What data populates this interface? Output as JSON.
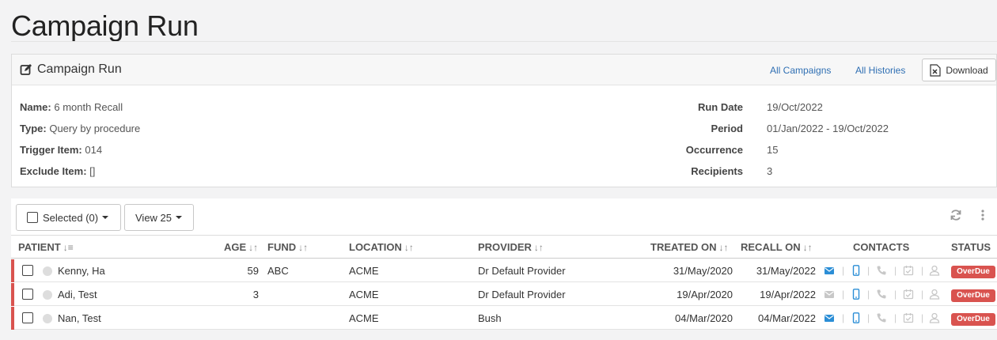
{
  "page": {
    "title": "Campaign Run"
  },
  "panel": {
    "title": "Campaign Run",
    "links": {
      "all_campaigns": "All Campaigns",
      "all_histories": "All Histories"
    },
    "download_label": "Download",
    "info_left": [
      {
        "label": "Name:",
        "value": "6 month Recall"
      },
      {
        "label": "Type:",
        "value": "Query by procedure"
      },
      {
        "label": "Trigger Item:",
        "value": "014"
      },
      {
        "label": "Exclude Item:",
        "value": "[]"
      }
    ],
    "info_right": [
      {
        "label": "Run Date",
        "value": "19/Oct/2022"
      },
      {
        "label": "Period",
        "value": "01/Jan/2022 - 19/Oct/2022"
      },
      {
        "label": "Occurrence",
        "value": "15"
      },
      {
        "label": "Recipients",
        "value": "3"
      }
    ]
  },
  "toolbar": {
    "selected_label": "Selected (0)",
    "view_label": "View 25"
  },
  "table": {
    "headers": {
      "patient": "PATIENT",
      "age": "AGE",
      "fund": "FUND",
      "location": "LOCATION",
      "provider": "PROVIDER",
      "treated_on": "TREATED ON",
      "recall_on": "RECALL ON",
      "contacts": "CONTACTS",
      "status": "STATUS"
    },
    "rows": [
      {
        "patient": "Kenny, Ha",
        "age": "59",
        "fund": "ABC",
        "location": "ACME",
        "provider": "Dr Default Provider",
        "treated_on": "31/May/2020",
        "recall_on": "31/May/2022",
        "email_active": true,
        "status": "OverDue"
      },
      {
        "patient": "Adi, Test",
        "age": "3",
        "fund": "",
        "location": "ACME",
        "provider": "Dr Default Provider",
        "treated_on": "19/Apr/2020",
        "recall_on": "19/Apr/2022",
        "email_active": false,
        "status": "OverDue"
      },
      {
        "patient": "Nan, Test",
        "age": "",
        "fund": "",
        "location": "ACME",
        "provider": "Bush",
        "treated_on": "04/Mar/2020",
        "recall_on": "04/Mar/2022",
        "email_active": true,
        "status": "OverDue"
      }
    ]
  },
  "colors": {
    "accent_link": "#2f6fb3",
    "overdue": "#d9534f",
    "email_active": "#2b8ed6",
    "mobile": "#2b8ed6",
    "inactive_icon": "#c8c8c8"
  },
  "icons": [
    "edit-icon",
    "excel-icon",
    "refresh-icon",
    "kebab-menu-icon",
    "email-icon",
    "mobile-icon",
    "phone-icon",
    "calendar-check-icon",
    "user-icon"
  ]
}
